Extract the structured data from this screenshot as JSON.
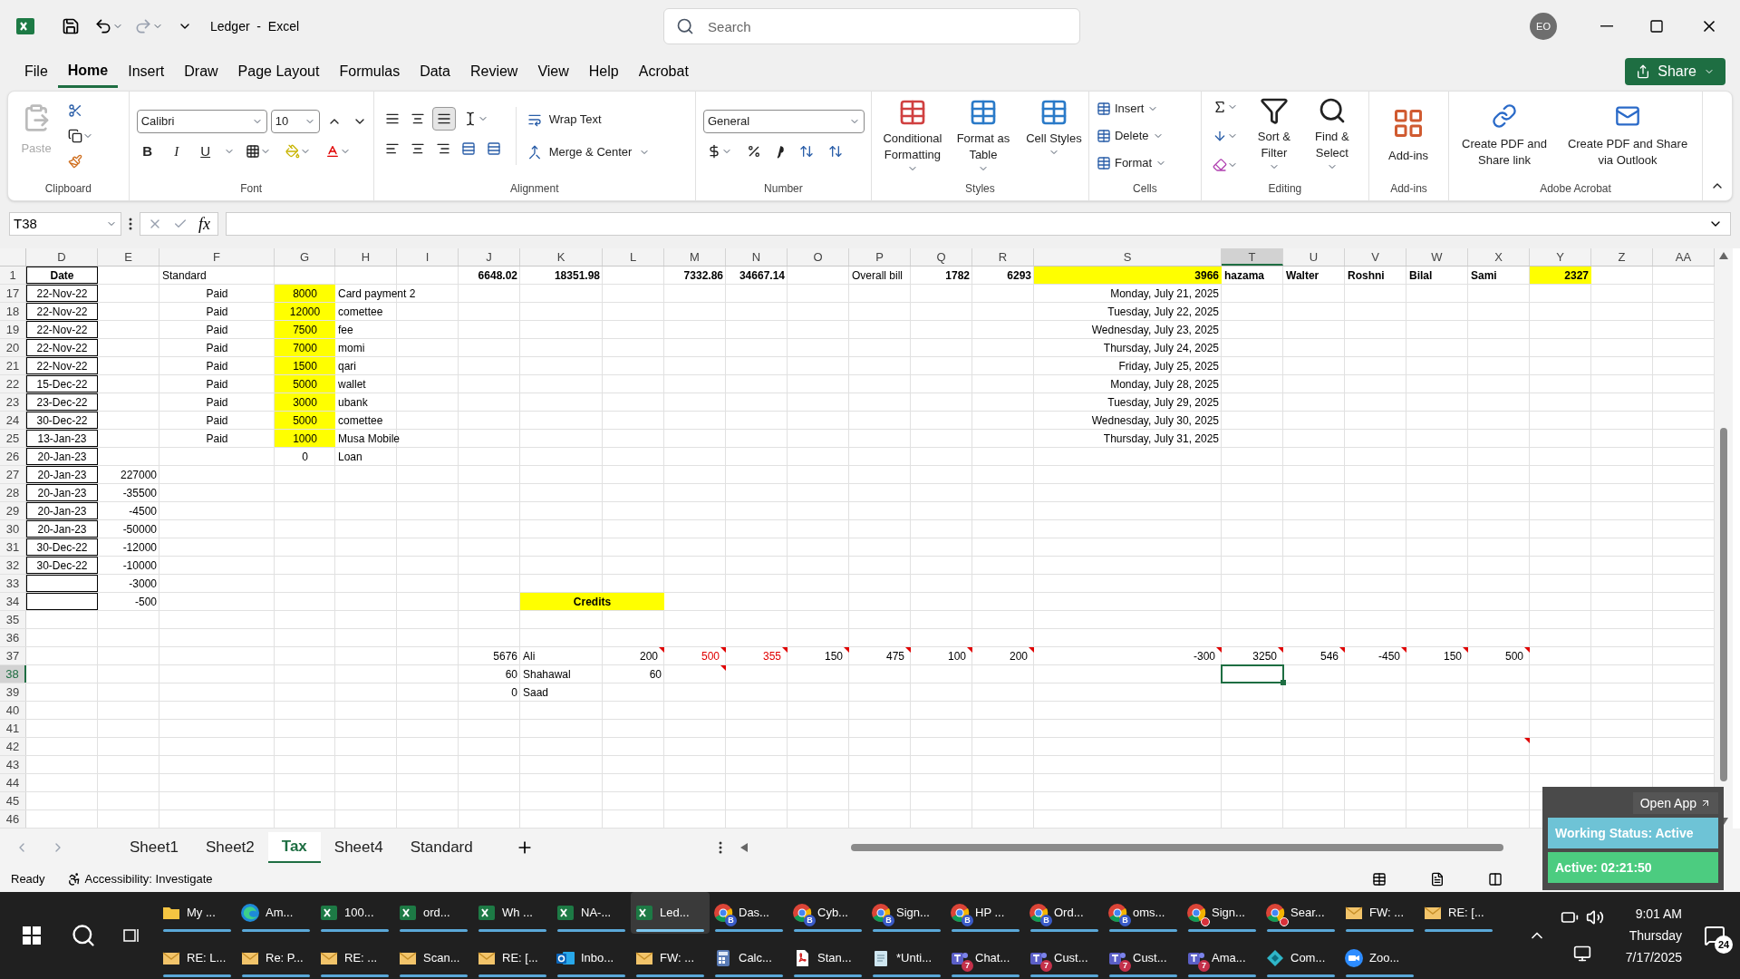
{
  "window": {
    "title": "Ledger  -  Excel",
    "user_initials": "EO"
  },
  "search": {
    "placeholder": "Search"
  },
  "menu_tabs": [
    {
      "label": "File",
      "selected": false
    },
    {
      "label": "Home",
      "selected": true
    },
    {
      "label": "Insert",
      "selected": false
    },
    {
      "label": "Draw",
      "selected": false
    },
    {
      "label": "Page Layout",
      "selected": false
    },
    {
      "label": "Formulas",
      "selected": false
    },
    {
      "label": "Data",
      "selected": false
    },
    {
      "label": "Review",
      "selected": false
    },
    {
      "label": "View",
      "selected": false
    },
    {
      "label": "Help",
      "selected": false
    },
    {
      "label": "Acrobat",
      "selected": false
    }
  ],
  "share_button": "Share",
  "ribbon": {
    "clipboard": {
      "paste": "Paste",
      "label": "Clipboard"
    },
    "font": {
      "name": "Calibri",
      "size": "10",
      "bold": "B",
      "italic": "I",
      "underline": "U",
      "label": "Font"
    },
    "alignment": {
      "wrap_text": "Wrap Text",
      "merge_center": "Merge & Center",
      "label": "Alignment"
    },
    "number": {
      "format": "General",
      "label": "Number"
    },
    "styles": {
      "buttons": [
        "Conditional Formatting",
        "Format as Table",
        "Cell Styles"
      ],
      "label": "Styles"
    },
    "cells": {
      "buttons": [
        "Insert",
        "Delete",
        "Format"
      ],
      "label": "Cells"
    },
    "editing": {
      "buttons": [
        "Sort & Filter",
        "Find & Select"
      ],
      "label": "Editing"
    },
    "add_ins": {
      "button": "Add-ins",
      "label": "Add-ins"
    },
    "acrobat": {
      "buttons": [
        "Create PDF and Share link",
        "Create PDF and Share via Outlook"
      ],
      "label": "Adobe Acrobat"
    }
  },
  "formula_bar": {
    "name_box": "T38",
    "function_label": "fx"
  },
  "grid": {
    "columns": [
      {
        "label": "D",
        "selected": false
      },
      {
        "label": "E",
        "selected": false
      },
      {
        "label": "F",
        "selected": false
      },
      {
        "label": "G",
        "selected": false
      },
      {
        "label": "H",
        "selected": false
      },
      {
        "label": "I",
        "selected": false
      },
      {
        "label": "J",
        "selected": false
      },
      {
        "label": "K",
        "selected": false
      },
      {
        "label": "L",
        "selected": false
      },
      {
        "label": "M",
        "selected": false
      },
      {
        "label": "N",
        "selected": false
      },
      {
        "label": "O",
        "selected": false
      },
      {
        "label": "P",
        "selected": false
      },
      {
        "label": "Q",
        "selected": false
      },
      {
        "label": "R",
        "selected": false
      },
      {
        "label": "S",
        "selected": false
      },
      {
        "label": "T",
        "selected": true
      },
      {
        "label": "U",
        "selected": false
      },
      {
        "label": "V",
        "selected": false
      },
      {
        "label": "W",
        "selected": false
      },
      {
        "label": "X",
        "selected": false
      },
      {
        "label": "Y",
        "selected": false
      },
      {
        "label": "Z",
        "selected": false
      },
      {
        "label": "AA",
        "selected": false
      }
    ],
    "rows": [
      {
        "number": "1",
        "selected": false,
        "cells": {
          "D": {
            "value": "Date",
            "kind": "centered",
            "bold": true,
            "bordered": true
          },
          "F": {
            "value": "Standard",
            "kind": "text"
          },
          "J": {
            "value": "6648.02",
            "kind": "number",
            "bold": true
          },
          "K": {
            "value": "18351.98",
            "kind": "number",
            "bold": true
          },
          "M": {
            "value": "7332.86",
            "kind": "number",
            "bold": true
          },
          "N": {
            "value": "34667.14",
            "kind": "number",
            "bold": true
          },
          "P": {
            "value": "Overall bill",
            "kind": "text"
          },
          "Q": {
            "value": "1782",
            "kind": "number",
            "bold": true
          },
          "R": {
            "value": "6293",
            "kind": "number",
            "bold": true
          },
          "S": {
            "value": "3966",
            "kind": "number",
            "bold": true,
            "highlight": true
          },
          "T": {
            "value": "hazama",
            "kind": "text",
            "bold": true
          },
          "U": {
            "value": "Walter",
            "kind": "text",
            "bold": true
          },
          "V": {
            "value": "Roshni",
            "kind": "text",
            "bold": true
          },
          "W": {
            "value": "Bilal",
            "kind": "text",
            "bold": true
          },
          "X": {
            "value": "Sami",
            "kind": "text",
            "bold": true
          },
          "Y": {
            "value": "2327",
            "kind": "number",
            "bold": true,
            "highlight": true
          }
        }
      },
      {
        "number": "17",
        "selected": false,
        "cells": {
          "D": {
            "value": "22-Nov-22",
            "kind": "centered",
            "bordered": true
          },
          "F": {
            "value": "Paid",
            "kind": "centered"
          },
          "G": {
            "value": "8000",
            "kind": "centered",
            "highlight": true
          },
          "H": {
            "value": "Card payment 2",
            "kind": "text"
          },
          "S": {
            "value": "Monday, July 21, 2025",
            "kind": "number"
          }
        }
      },
      {
        "number": "18",
        "selected": false,
        "cells": {
          "D": {
            "value": "22-Nov-22",
            "kind": "centered",
            "bordered": true
          },
          "F": {
            "value": "Paid",
            "kind": "centered"
          },
          "G": {
            "value": "12000",
            "kind": "centered",
            "highlight": true
          },
          "H": {
            "value": "comettee",
            "kind": "text"
          },
          "S": {
            "value": "Tuesday, July 22, 2025",
            "kind": "number"
          }
        }
      },
      {
        "number": "19",
        "selected": false,
        "cells": {
          "D": {
            "value": "22-Nov-22",
            "kind": "centered",
            "bordered": true
          },
          "F": {
            "value": "Paid",
            "kind": "centered"
          },
          "G": {
            "value": "7500",
            "kind": "centered",
            "highlight": true
          },
          "H": {
            "value": "fee",
            "kind": "text"
          },
          "S": {
            "value": "Wednesday, July 23, 2025",
            "kind": "number"
          }
        }
      },
      {
        "number": "20",
        "selected": false,
        "cells": {
          "D": {
            "value": "22-Nov-22",
            "kind": "centered",
            "bordered": true
          },
          "F": {
            "value": "Paid",
            "kind": "centered"
          },
          "G": {
            "value": "7000",
            "kind": "centered",
            "highlight": true
          },
          "H": {
            "value": "momi",
            "kind": "text"
          },
          "S": {
            "value": "Thursday, July 24, 2025",
            "kind": "number"
          }
        }
      },
      {
        "number": "21",
        "selected": false,
        "cells": {
          "D": {
            "value": "22-Nov-22",
            "kind": "centered",
            "bordered": true
          },
          "F": {
            "value": "Paid",
            "kind": "centered"
          },
          "G": {
            "value": "1500",
            "kind": "centered",
            "highlight": true
          },
          "H": {
            "value": "qari",
            "kind": "text"
          },
          "S": {
            "value": "Friday, July 25, 2025",
            "kind": "number"
          }
        }
      },
      {
        "number": "22",
        "selected": false,
        "cells": {
          "D": {
            "value": "15-Dec-22",
            "kind": "centered",
            "bordered": true
          },
          "F": {
            "value": "Paid",
            "kind": "centered"
          },
          "G": {
            "value": "5000",
            "kind": "centered",
            "highlight": true
          },
          "H": {
            "value": "wallet",
            "kind": "text"
          },
          "S": {
            "value": "Monday, July 28, 2025",
            "kind": "number"
          }
        }
      },
      {
        "number": "23",
        "selected": false,
        "cells": {
          "D": {
            "value": "23-Dec-22",
            "kind": "centered",
            "bordered": true
          },
          "F": {
            "value": "Paid",
            "kind": "centered"
          },
          "G": {
            "value": "3000",
            "kind": "centered",
            "highlight": true
          },
          "H": {
            "value": "ubank",
            "kind": "text"
          },
          "S": {
            "value": "Tuesday, July 29, 2025",
            "kind": "number"
          }
        }
      },
      {
        "number": "24",
        "selected": false,
        "cells": {
          "D": {
            "value": "30-Dec-22",
            "kind": "centered",
            "bordered": true
          },
          "F": {
            "value": "Paid",
            "kind": "centered"
          },
          "G": {
            "value": "5000",
            "kind": "centered",
            "highlight": true
          },
          "H": {
            "value": "comettee",
            "kind": "text"
          },
          "S": {
            "value": "Wednesday, July 30, 2025",
            "kind": "number"
          }
        }
      },
      {
        "number": "25",
        "selected": false,
        "cells": {
          "D": {
            "value": "13-Jan-23",
            "kind": "centered",
            "bordered": true
          },
          "F": {
            "value": "Paid",
            "kind": "centered"
          },
          "G": {
            "value": "1000",
            "kind": "centered",
            "highlight": true
          },
          "H": {
            "value": "Musa Mobile",
            "kind": "text"
          },
          "S": {
            "value": "Thursday, July 31, 2025",
            "kind": "number"
          }
        }
      },
      {
        "number": "26",
        "selected": false,
        "cells": {
          "D": {
            "value": "20-Jan-23",
            "kind": "centered",
            "bordered": true
          },
          "G": {
            "value": "0",
            "kind": "centered"
          },
          "H": {
            "value": "Loan",
            "kind": "text"
          }
        }
      },
      {
        "number": "27",
        "selected": false,
        "cells": {
          "D": {
            "value": "20-Jan-23",
            "kind": "centered",
            "bordered": true
          },
          "E": {
            "value": "227000",
            "kind": "number"
          }
        }
      },
      {
        "number": "28",
        "selected": false,
        "cells": {
          "D": {
            "value": "20-Jan-23",
            "kind": "centered",
            "bordered": true
          },
          "E": {
            "value": "-35500",
            "kind": "number"
          }
        }
      },
      {
        "number": "29",
        "selected": false,
        "cells": {
          "D": {
            "value": "20-Jan-23",
            "kind": "centered",
            "bordered": true
          },
          "E": {
            "value": "-4500",
            "kind": "number"
          }
        }
      },
      {
        "number": "30",
        "selected": false,
        "cells": {
          "D": {
            "value": "20-Jan-23",
            "kind": "centered",
            "bordered": true
          },
          "E": {
            "value": "-50000",
            "kind": "number"
          }
        }
      },
      {
        "number": "31",
        "selected": false,
        "cells": {
          "D": {
            "value": "30-Dec-22",
            "kind": "centered",
            "bordered": true
          },
          "E": {
            "value": "-12000",
            "kind": "number"
          }
        }
      },
      {
        "number": "32",
        "selected": false,
        "cells": {
          "D": {
            "value": "30-Dec-22",
            "kind": "centered",
            "bordered": true
          },
          "E": {
            "value": "-10000",
            "kind": "number"
          }
        }
      },
      {
        "number": "33",
        "selected": false,
        "cells": {
          "D": {
            "bordered": true
          },
          "E": {
            "value": "-3000",
            "kind": "number"
          }
        }
      },
      {
        "number": "34",
        "selected": false,
        "cells": {
          "D": {
            "bordered": true
          },
          "E": {
            "value": "-500",
            "kind": "number"
          },
          "K": {
            "value": "Credits",
            "kind": "centered",
            "bold": true,
            "highlight": true,
            "merged": true
          }
        }
      },
      {
        "number": "35",
        "selected": false,
        "cells": {}
      },
      {
        "number": "36",
        "selected": false,
        "cells": {}
      },
      {
        "number": "37",
        "selected": false,
        "cells": {
          "J": {
            "value": "5676",
            "kind": "number"
          },
          "K": {
            "value": "Ali",
            "kind": "text"
          },
          "L": {
            "value": "200",
            "kind": "number",
            "comment": true
          },
          "M": {
            "value": "500",
            "kind": "number",
            "comment": true,
            "red": true
          },
          "N": {
            "value": "355",
            "kind": "number",
            "comment": true,
            "red": true
          },
          "O": {
            "value": "150",
            "kind": "number",
            "comment": true
          },
          "P": {
            "value": "475",
            "kind": "number",
            "comment": true
          },
          "Q": {
            "value": "100",
            "kind": "number",
            "comment": true
          },
          "R": {
            "value": "200",
            "kind": "number",
            "comment": true
          },
          "S": {
            "value": "-300",
            "kind": "number",
            "comment": true
          },
          "T": {
            "value": "3250",
            "kind": "number",
            "comment": true
          },
          "U": {
            "value": "546",
            "kind": "number",
            "comment": true
          },
          "V": {
            "value": "-450",
            "kind": "number",
            "comment": true
          },
          "W": {
            "value": "150",
            "kind": "number",
            "comment": true
          },
          "X": {
            "value": "500",
            "kind": "number",
            "comment": true
          }
        }
      },
      {
        "number": "38",
        "selected": true,
        "cells": {
          "J": {
            "value": "60",
            "kind": "number"
          },
          "K": {
            "value": "Shahawal",
            "kind": "text"
          },
          "L": {
            "value": "60",
            "kind": "number"
          },
          "M": {
            "comment": true
          },
          "T": {
            "selected": true
          }
        }
      },
      {
        "number": "39",
        "selected": false,
        "cells": {
          "J": {
            "value": "0",
            "kind": "number"
          },
          "K": {
            "value": "Saad",
            "kind": "text"
          }
        }
      },
      {
        "number": "40",
        "selected": false,
        "cells": {}
      },
      {
        "number": "41",
        "selected": false,
        "cells": {}
      },
      {
        "number": "42",
        "selected": false,
        "cells": {
          "X": {
            "comment": true
          }
        }
      },
      {
        "number": "43",
        "selected": false,
        "cells": {}
      },
      {
        "number": "44",
        "selected": false,
        "cells": {}
      },
      {
        "number": "45",
        "selected": false,
        "cells": {}
      },
      {
        "number": "46",
        "selected": false,
        "cells": {}
      }
    ]
  },
  "sheet_tabs": [
    {
      "label": "Sheet1",
      "selected": false
    },
    {
      "label": "Sheet2",
      "selected": false
    },
    {
      "label": "Tax",
      "selected": true
    },
    {
      "label": "Sheet4",
      "selected": false
    },
    {
      "label": "Standard",
      "selected": false
    }
  ],
  "status_bar": {
    "ready": "Ready",
    "accessibility": "Accessibility: Investigate"
  },
  "widget": {
    "open_app": "Open App",
    "working_status": "Working Status: Active",
    "active_time": "Active: 02:21:50"
  },
  "taskbar": {
    "rows": [
      [
        {
          "kind": "folder",
          "label": "My ...",
          "selected": false
        },
        {
          "kind": "edge",
          "label": "Am...",
          "selected": false
        },
        {
          "kind": "excel",
          "label": "100...",
          "selected": false
        },
        {
          "kind": "excel",
          "label": "ord...",
          "selected": false
        },
        {
          "kind": "excel",
          "label": "Wh ...",
          "selected": false
        },
        {
          "kind": "excel",
          "label": "NA-...",
          "selected": false
        },
        {
          "kind": "excel",
          "label": "Led...",
          "selected": true
        },
        {
          "kind": "chrome",
          "label": "Das...",
          "badge": "B",
          "selected": false
        },
        {
          "kind": "chrome",
          "label": "Cyb...",
          "badge": "B",
          "selected": false
        },
        {
          "kind": "chrome",
          "label": "Sign...",
          "badge": "B",
          "selected": false
        },
        {
          "kind": "chrome",
          "label": "HP ...",
          "badge": "B",
          "selected": false
        },
        {
          "kind": "chrome",
          "label": "Ord...",
          "badge": "B",
          "selected": false
        },
        {
          "kind": "chrome",
          "label": "oms...",
          "badge": "B",
          "selected": false
        },
        {
          "kind": "chrome_alt",
          "label": "Sign...",
          "selected": false
        },
        {
          "kind": "chrome_alt",
          "label": "Sear...",
          "selected": false
        },
        {
          "kind": "mail",
          "label": "FW: ...",
          "selected": false
        },
        {
          "kind": "mail",
          "label": "RE: [...",
          "selected": false
        }
      ],
      [
        {
          "kind": "mail",
          "label": "RE: L...",
          "selected": false
        },
        {
          "kind": "mail",
          "label": "Re: P...",
          "selected": false
        },
        {
          "kind": "mail",
          "label": "RE: ...",
          "selected": false
        },
        {
          "kind": "mail",
          "label": "Scan...",
          "selected": false
        },
        {
          "kind": "mail",
          "label": "RE: [...",
          "selected": false
        },
        {
          "kind": "outlook",
          "label": "Inbo...",
          "selected": false
        },
        {
          "kind": "mail",
          "label": "FW: ...",
          "selected": false
        },
        {
          "kind": "calculator",
          "label": "Calc...",
          "selected": false
        },
        {
          "kind": "pdf",
          "label": "Stan...",
          "selected": false
        },
        {
          "kind": "notepad",
          "label": "*Unti...",
          "selected": false
        },
        {
          "kind": "teams",
          "label": "Chat...",
          "badge": "7",
          "selected": false
        },
        {
          "kind": "teams",
          "label": "Cust...",
          "badge": "7",
          "selected": false
        },
        {
          "kind": "teams",
          "label": "Cust...",
          "badge": "7",
          "selected": false
        },
        {
          "kind": "teams",
          "label": "Ama...",
          "badge": "7",
          "selected": false
        },
        {
          "kind": "app",
          "label": "Com...",
          "selected": false
        },
        {
          "kind": "zoom",
          "label": "Zoo...",
          "selected": false
        }
      ]
    ],
    "clock": {
      "time": "9:01 AM",
      "day": "Thursday",
      "date": "7/17/2025"
    },
    "notifications": "24"
  }
}
